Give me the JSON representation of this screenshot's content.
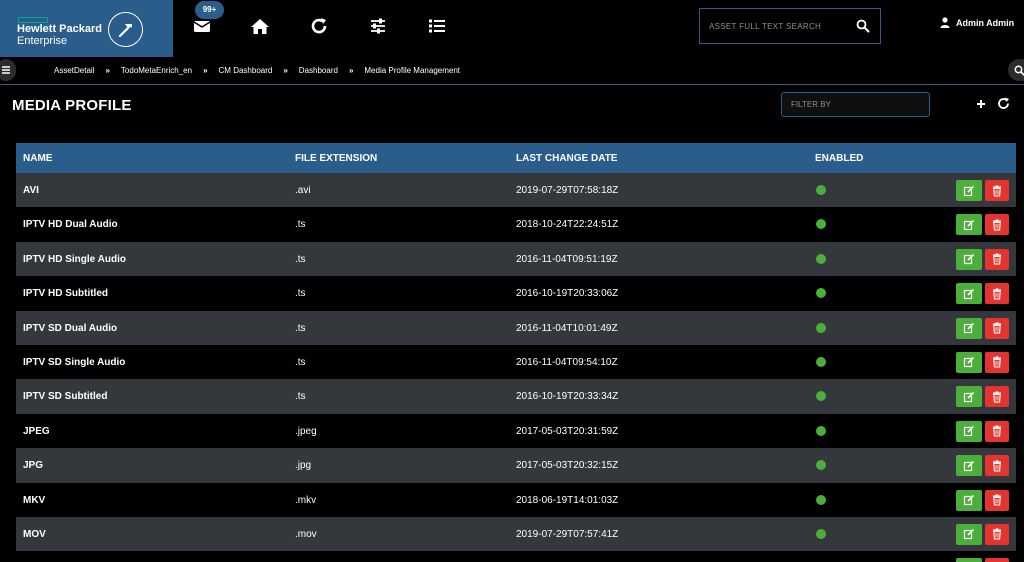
{
  "header": {
    "brand_line1": "Hewlett Packard",
    "brand_line2": "Enterprise",
    "notification_count": "99+",
    "nav_icons": [
      "envelope-icon",
      "home-icon",
      "refresh-icon",
      "sliders-icon",
      "list-icon"
    ],
    "search_placeholder": "ASSET FULL TEXT SEARCH",
    "user_name": "Admin Admin"
  },
  "breadcrumb": {
    "items": [
      "AssetDetail",
      "TodoMetaEnrich_en",
      "CM Dashboard",
      "Dashboard",
      "Media Profile Management"
    ],
    "separator": "»"
  },
  "page": {
    "title": "MEDIA PROFILE",
    "filter_placeholder": "FILTER BY"
  },
  "table": {
    "headers": {
      "name": "NAME",
      "extension": "FILE EXTENSION",
      "date": "LAST CHANGE DATE",
      "enabled": "ENABLED"
    },
    "rows": [
      {
        "name": "AVI",
        "extension": ".avi",
        "date": "2019-07-29T07:58:18Z",
        "enabled": true
      },
      {
        "name": "IPTV HD Dual Audio",
        "extension": ".ts",
        "date": "2018-10-24T22:24:51Z",
        "enabled": true
      },
      {
        "name": "IPTV HD Single Audio",
        "extension": ".ts",
        "date": "2016-11-04T09:51:19Z",
        "enabled": true
      },
      {
        "name": "IPTV HD Subtitled",
        "extension": ".ts",
        "date": "2016-10-19T20:33:06Z",
        "enabled": true
      },
      {
        "name": "IPTV SD Dual Audio",
        "extension": ".ts",
        "date": "2016-11-04T10:01:49Z",
        "enabled": true
      },
      {
        "name": "IPTV SD Single Audio",
        "extension": ".ts",
        "date": "2016-11-04T09:54:10Z",
        "enabled": true
      },
      {
        "name": "IPTV SD Subtitled",
        "extension": ".ts",
        "date": "2016-10-19T20:33:34Z",
        "enabled": true
      },
      {
        "name": "JPEG",
        "extension": ".jpeg",
        "date": "2017-05-03T20:31:59Z",
        "enabled": true
      },
      {
        "name": "JPG",
        "extension": ".jpg",
        "date": "2017-05-03T20:32:15Z",
        "enabled": true
      },
      {
        "name": "MKV",
        "extension": ".mkv",
        "date": "2018-06-19T14:01:03Z",
        "enabled": true
      },
      {
        "name": "MOV",
        "extension": ".mov",
        "date": "2019-07-29T07:57:41Z",
        "enabled": true
      },
      {
        "name": "",
        "extension": "",
        "date": "",
        "enabled": true
      }
    ]
  },
  "colors": {
    "brand_blue": "#2a5d8c",
    "hpe_green": "#01a982",
    "enabled_green": "#4caf3c",
    "edit_green": "#4caf3c",
    "delete_red": "#e3342f",
    "row_alt": "#34383d"
  }
}
